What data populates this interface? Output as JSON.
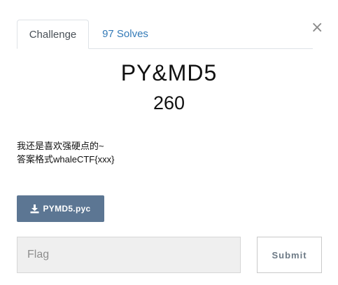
{
  "close_label": "×",
  "tabs": [
    {
      "label": "Challenge"
    },
    {
      "label": "97 Solves"
    }
  ],
  "challenge": {
    "name": "PY&MD5",
    "points": "260",
    "description_lines": [
      "我还是喜欢强硬点的~",
      "答案格式whaleCTF{xxx}"
    ]
  },
  "file": {
    "icon": "download-icon",
    "label": "PYMD5.pyc"
  },
  "flag_input": {
    "placeholder": "Flag",
    "value": ""
  },
  "submit_label": "Submit",
  "colors": {
    "link": "#337ab7",
    "file_button": "#5c7693",
    "input_bg": "#efefef"
  }
}
